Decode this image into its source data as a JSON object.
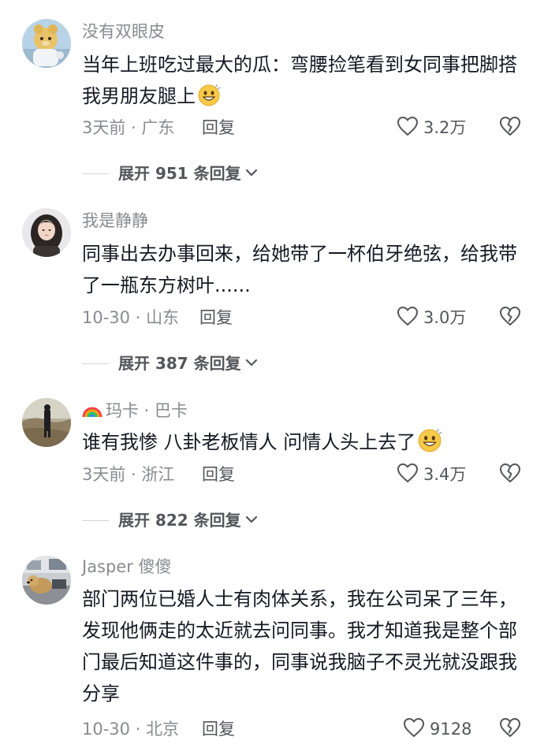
{
  "comments": [
    {
      "username": "没有双眼皮",
      "text": "当年上班吃过最大的瓜：弯腰捡笔看到女同事把脚搭我男朋友腿上",
      "has_emoji": true,
      "date": "3天前",
      "location": "广东",
      "reply_label": "回复",
      "likes": "3.2万",
      "expand_label": "展开 951 条回复"
    },
    {
      "username": "我是静静",
      "text": "同事出去办事回来，给她带了一杯伯牙绝弦，给我带了一瓶东方树叶......",
      "has_emoji": false,
      "date": "10-30",
      "location": "山东",
      "reply_label": "回复",
      "likes": "3.0万",
      "expand_label": "展开 387 条回复"
    },
    {
      "username": "玛卡 · 巴卡",
      "text": "谁有我惨 八卦老板情人 问情人头上去了",
      "has_emoji": true,
      "date": "3天前",
      "location": "浙江",
      "reply_label": "回复",
      "likes": "3.4万",
      "expand_label": "展开 822 条回复"
    },
    {
      "username": "Jasper 傻傻",
      "text": "部门两位已婚人士有肉体关系，我在公司呆了三年，发现他俩走的太近就去问同事。我才知道我是整个部门最后知道这件事的，同事说我脑子不灵光就没跟我分享",
      "has_emoji": false,
      "date": "10-30",
      "location": "北京",
      "reply_label": "回复",
      "likes": "9128"
    }
  ],
  "meta_separator": " · ",
  "icons": {
    "like": "heart-outline-icon",
    "dislike": "broken-heart-icon",
    "expand": "chevron-down-icon",
    "emoji": "grin-emoji-icon",
    "badge": "rainbow-icon"
  }
}
